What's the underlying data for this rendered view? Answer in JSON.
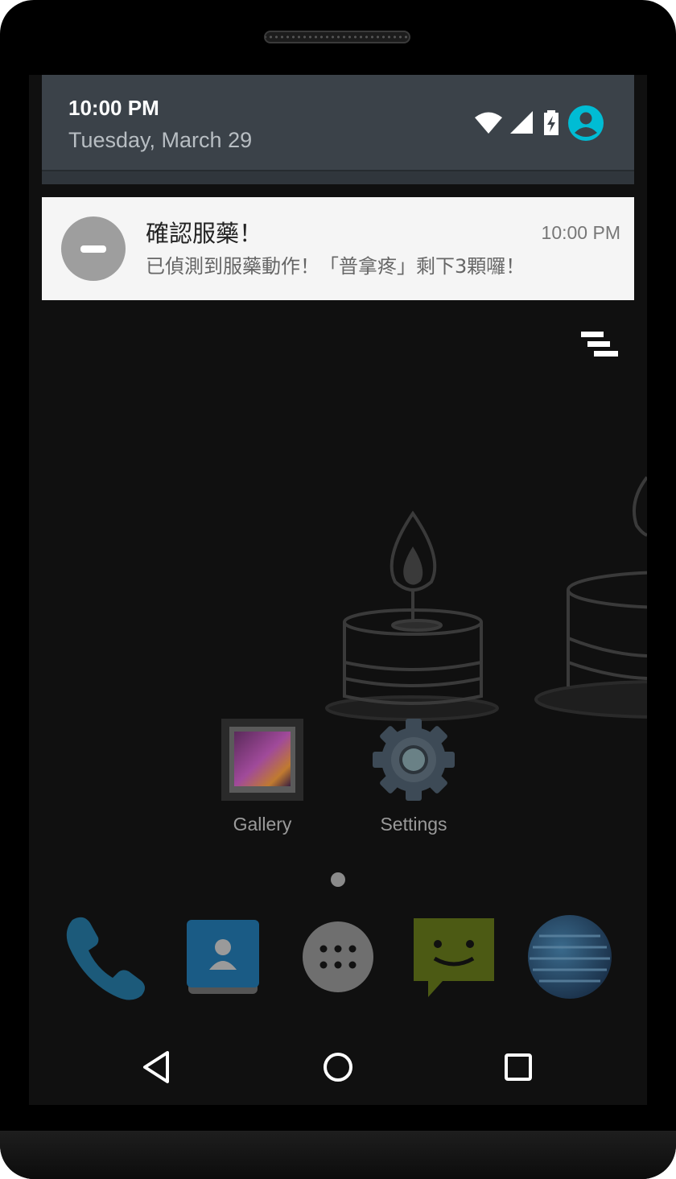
{
  "status_shade": {
    "time": "10:00 PM",
    "date": "Tuesday, March 29",
    "icons": [
      "wifi-icon",
      "signal-icon",
      "battery-charging-icon",
      "user-avatar-icon"
    ],
    "avatar_color": "#00bcd4"
  },
  "notification": {
    "title": "確認服藥！",
    "time": "10:00 PM",
    "text": "已偵測到服藥動作！「普拿疼」剩下3顆囉！",
    "icon": "minus-circle-icon",
    "background": "#f5f5f5"
  },
  "dismiss_all": {
    "icon": "clear-all-icon"
  },
  "home": {
    "apps": [
      {
        "label": "Gallery",
        "icon": "gallery-icon"
      },
      {
        "label": "Settings",
        "icon": "settings-gear-icon"
      }
    ]
  },
  "dock": [
    {
      "icon": "phone-icon"
    },
    {
      "icon": "contacts-icon"
    },
    {
      "icon": "app-drawer-icon"
    },
    {
      "icon": "messaging-icon"
    },
    {
      "icon": "browser-globe-icon"
    }
  ],
  "nav": [
    "back-icon",
    "home-icon",
    "recents-icon"
  ]
}
